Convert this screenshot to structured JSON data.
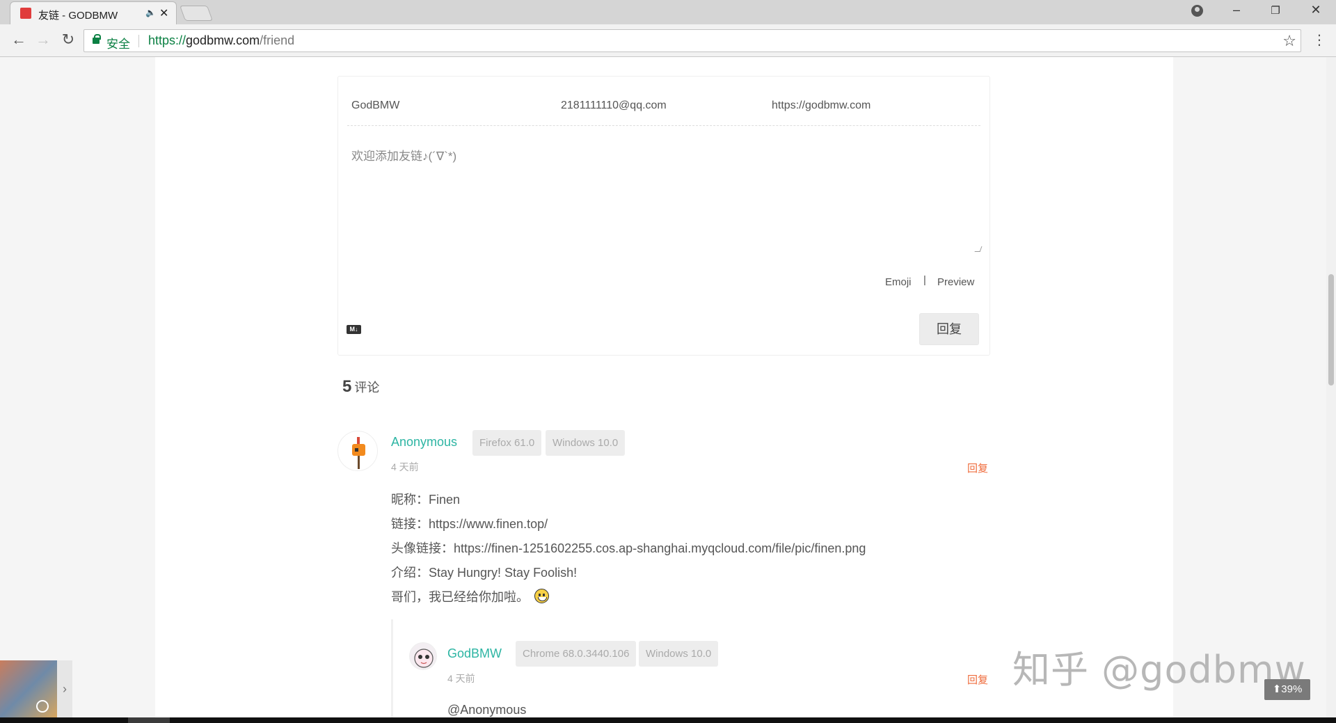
{
  "browser": {
    "tab_title": "友链 - GODBMW",
    "tab_audio": "🔈",
    "tab_close": "✕",
    "secure_label": "安全",
    "url_scheme": "https://",
    "url_host": "godbmw.com",
    "url_path": "/friend",
    "back": "←",
    "forward": "→",
    "reload": "↻",
    "star": "☆",
    "menu": "⋮",
    "minimize": "–",
    "restore": "❐",
    "close": "✕"
  },
  "form": {
    "name_value": "GodBMW",
    "email_value": "2181111110@qq.com",
    "site_value": "https://godbmw.com",
    "textarea_placeholder": "欢迎添加友链♪(´∇`*)",
    "emoji_label": "Emoji",
    "separator": "|",
    "preview_label": "Preview",
    "md_icon": "M↓",
    "submit_label": "回复"
  },
  "comments_count": {
    "number": "5",
    "label": "评论"
  },
  "comments": [
    {
      "nick": "Anonymous",
      "browser": "Firefox 61.0",
      "os": "Windows 10.0",
      "time": "4 天前",
      "reply_label": "回复",
      "lines": [
        "昵称：Finen",
        "链接：https://www.finen.top/",
        "头像链接：https://finen-1251602255.cos.ap-shanghai.myqcloud.com/file/pic/finen.png",
        "介绍：Stay Hungry! Stay Foolish!",
        "哥们，我已经给你加啦。"
      ],
      "replies": [
        {
          "nick": "GodBMW",
          "browser": "Chrome 68.0.3440.106",
          "os": "Windows 10.0",
          "time": "4 天前",
          "reply_label": "回复",
          "lines": [
            "@Anonymous"
          ]
        }
      ]
    }
  ],
  "overlay": {
    "watermark": "知乎 @godbmw",
    "scroll_percent": "⬆39%",
    "music_toggle": "›"
  },
  "colors": {
    "accent_nick": "#2db5a3",
    "reply_link": "#ef6c3d",
    "secure_green": "#0b8043"
  }
}
